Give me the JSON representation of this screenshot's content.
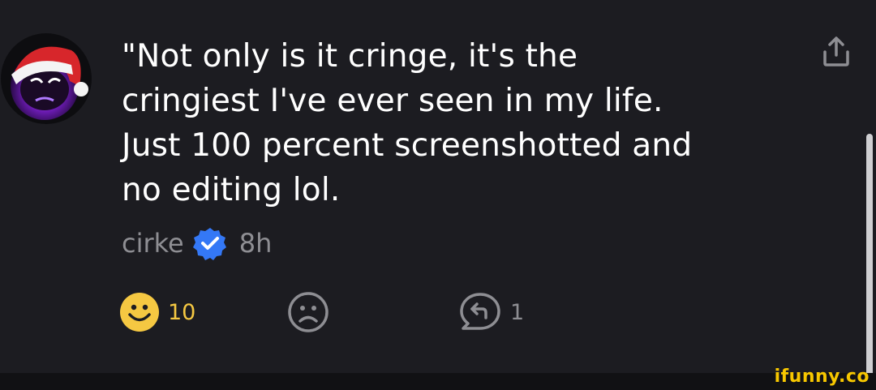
{
  "comment": {
    "text": "\"Not only is it cringe, it's the cringiest I've ever seen in my life. Just 100 percent screenshotted and no editing lol.",
    "lines": [
      "\"Not only is it cringe, it's the",
      "cringiest I've ever seen in my life.",
      "Just 100 percent screenshotted and",
      "no editing lol."
    ],
    "author": "cirke",
    "verified": true,
    "time": "8h"
  },
  "actions": {
    "like_count": "10",
    "reply_count": "1"
  },
  "icons": {
    "avatar": "santa-hat-avatar-icon",
    "verified": "verified-badge-icon",
    "like": "smile-icon",
    "dislike": "frown-icon",
    "reply": "reply-icon",
    "share": "share-icon"
  },
  "colors": {
    "background": "#1c1c21",
    "text": "#ffffff",
    "muted": "#8e8e93",
    "like": "#f5c842",
    "verified": "#3478f6",
    "watermark": "#f7c700"
  },
  "watermark": "ifunny.co"
}
